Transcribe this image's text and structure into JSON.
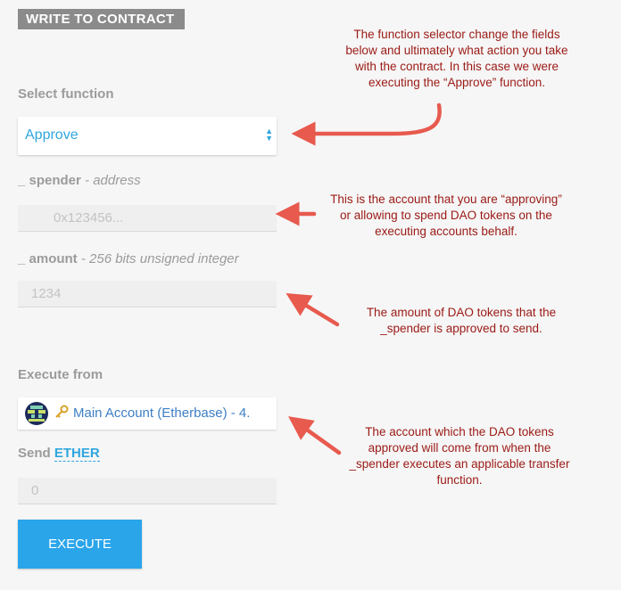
{
  "header": {
    "title": "WRITE TO CONTRACT"
  },
  "select_function": {
    "label": "Select function",
    "value": "Approve"
  },
  "spender": {
    "label_name": "_ spender",
    "label_type": " - address",
    "placeholder": "0x123456..."
  },
  "amount": {
    "label_name": "_ amount",
    "label_type": " - 256 bits unsigned integer",
    "placeholder": "1234"
  },
  "execute_from": {
    "label": "Execute from",
    "account": "Main Account (Etherbase) - 4."
  },
  "send": {
    "label": "Send",
    "unit": "ETHER",
    "placeholder": "0"
  },
  "execute_button": {
    "label": "EXECUTE"
  },
  "annotations": {
    "function_selector": "The function selector change the fields below and ultimately what action you take with the contract. In this case we were executing the “Approve” function.",
    "spender": "This is the account that you are “approving” or allowing to spend DAO tokens on the executing accounts behalf.",
    "amount": "The amount of DAO tokens that the _spender is approved to send.",
    "account": "The account which the DAO tokens approved will come from when the _spender executes an applicable transfer function."
  },
  "colors": {
    "accent": "#2fa6de",
    "button": "#2aa5ea",
    "annotation_text": "#9a1a15",
    "arrow": "#e85a4e"
  },
  "icons": [
    "select-arrows-icon",
    "identicon-icon",
    "key-icon",
    "arrow-icon"
  ]
}
